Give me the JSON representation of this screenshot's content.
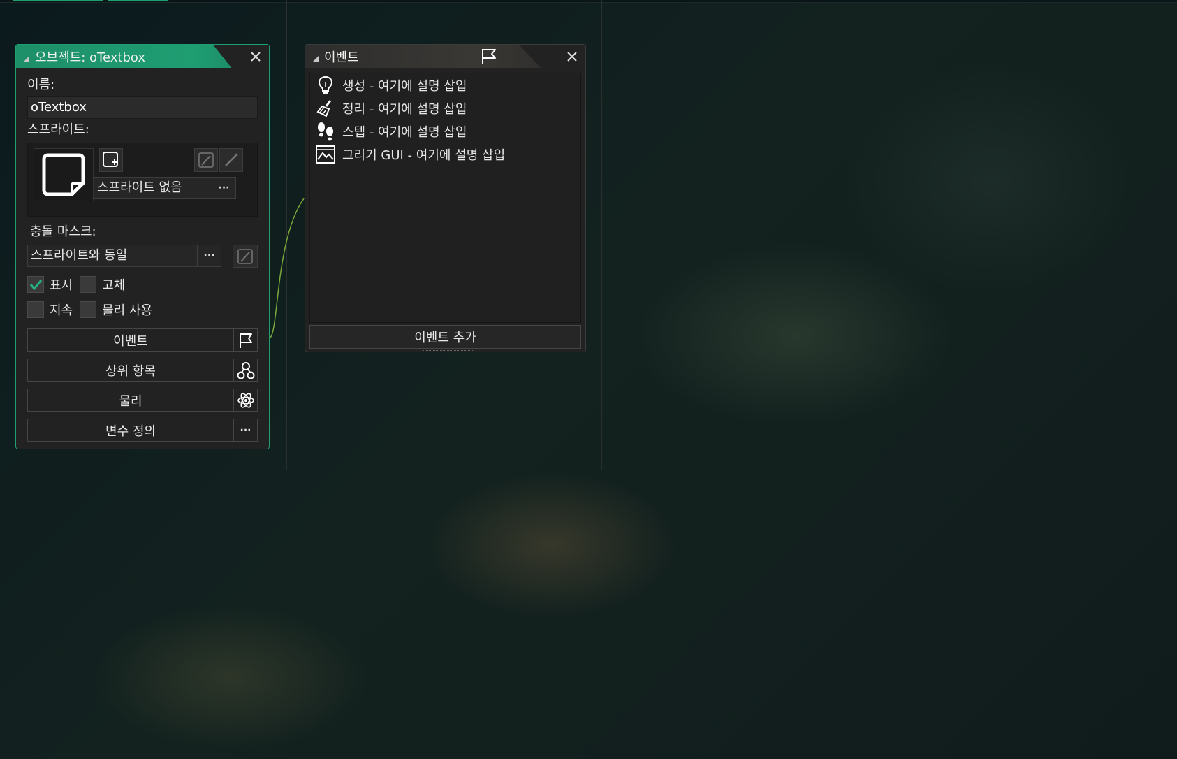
{
  "object_window": {
    "title": "오브젝트: oTextbox",
    "name_label": "이름:",
    "name_value": "oTextbox",
    "sprite_label": "스프라이트:",
    "sprite_value": "스프라이트 없음",
    "sprite_dots": "···",
    "mask_label": "충돌 마스크:",
    "mask_value": "스프라이트와 동일",
    "mask_dots": "···",
    "checkboxes": [
      {
        "label": "표시",
        "checked": true
      },
      {
        "label": "고체",
        "checked": false
      },
      {
        "label": "지속",
        "checked": false
      },
      {
        "label": "물리 사용",
        "checked": false
      }
    ],
    "buttons": {
      "events": "이벤트",
      "parent": "상위 항목",
      "physics": "물리",
      "variables": "변수 정의",
      "variables_dots": "···"
    }
  },
  "events_window": {
    "title": "이벤트",
    "events": [
      {
        "label": "생성 - 여기에 설명 삽입",
        "icon": "lightbulb-icon"
      },
      {
        "label": "정리 - 여기에 설명 삽입",
        "icon": "broom-icon"
      },
      {
        "label": "스텝 - 여기에 설명 삽입",
        "icon": "footsteps-icon"
      },
      {
        "label": "그리기 GUI - 여기에 설명 삽입",
        "icon": "image-icon"
      }
    ],
    "add_button": "이벤트 추가"
  },
  "colors": {
    "accent": "#1f9e72",
    "panel": "#222222",
    "text": "#e6e6e6"
  }
}
